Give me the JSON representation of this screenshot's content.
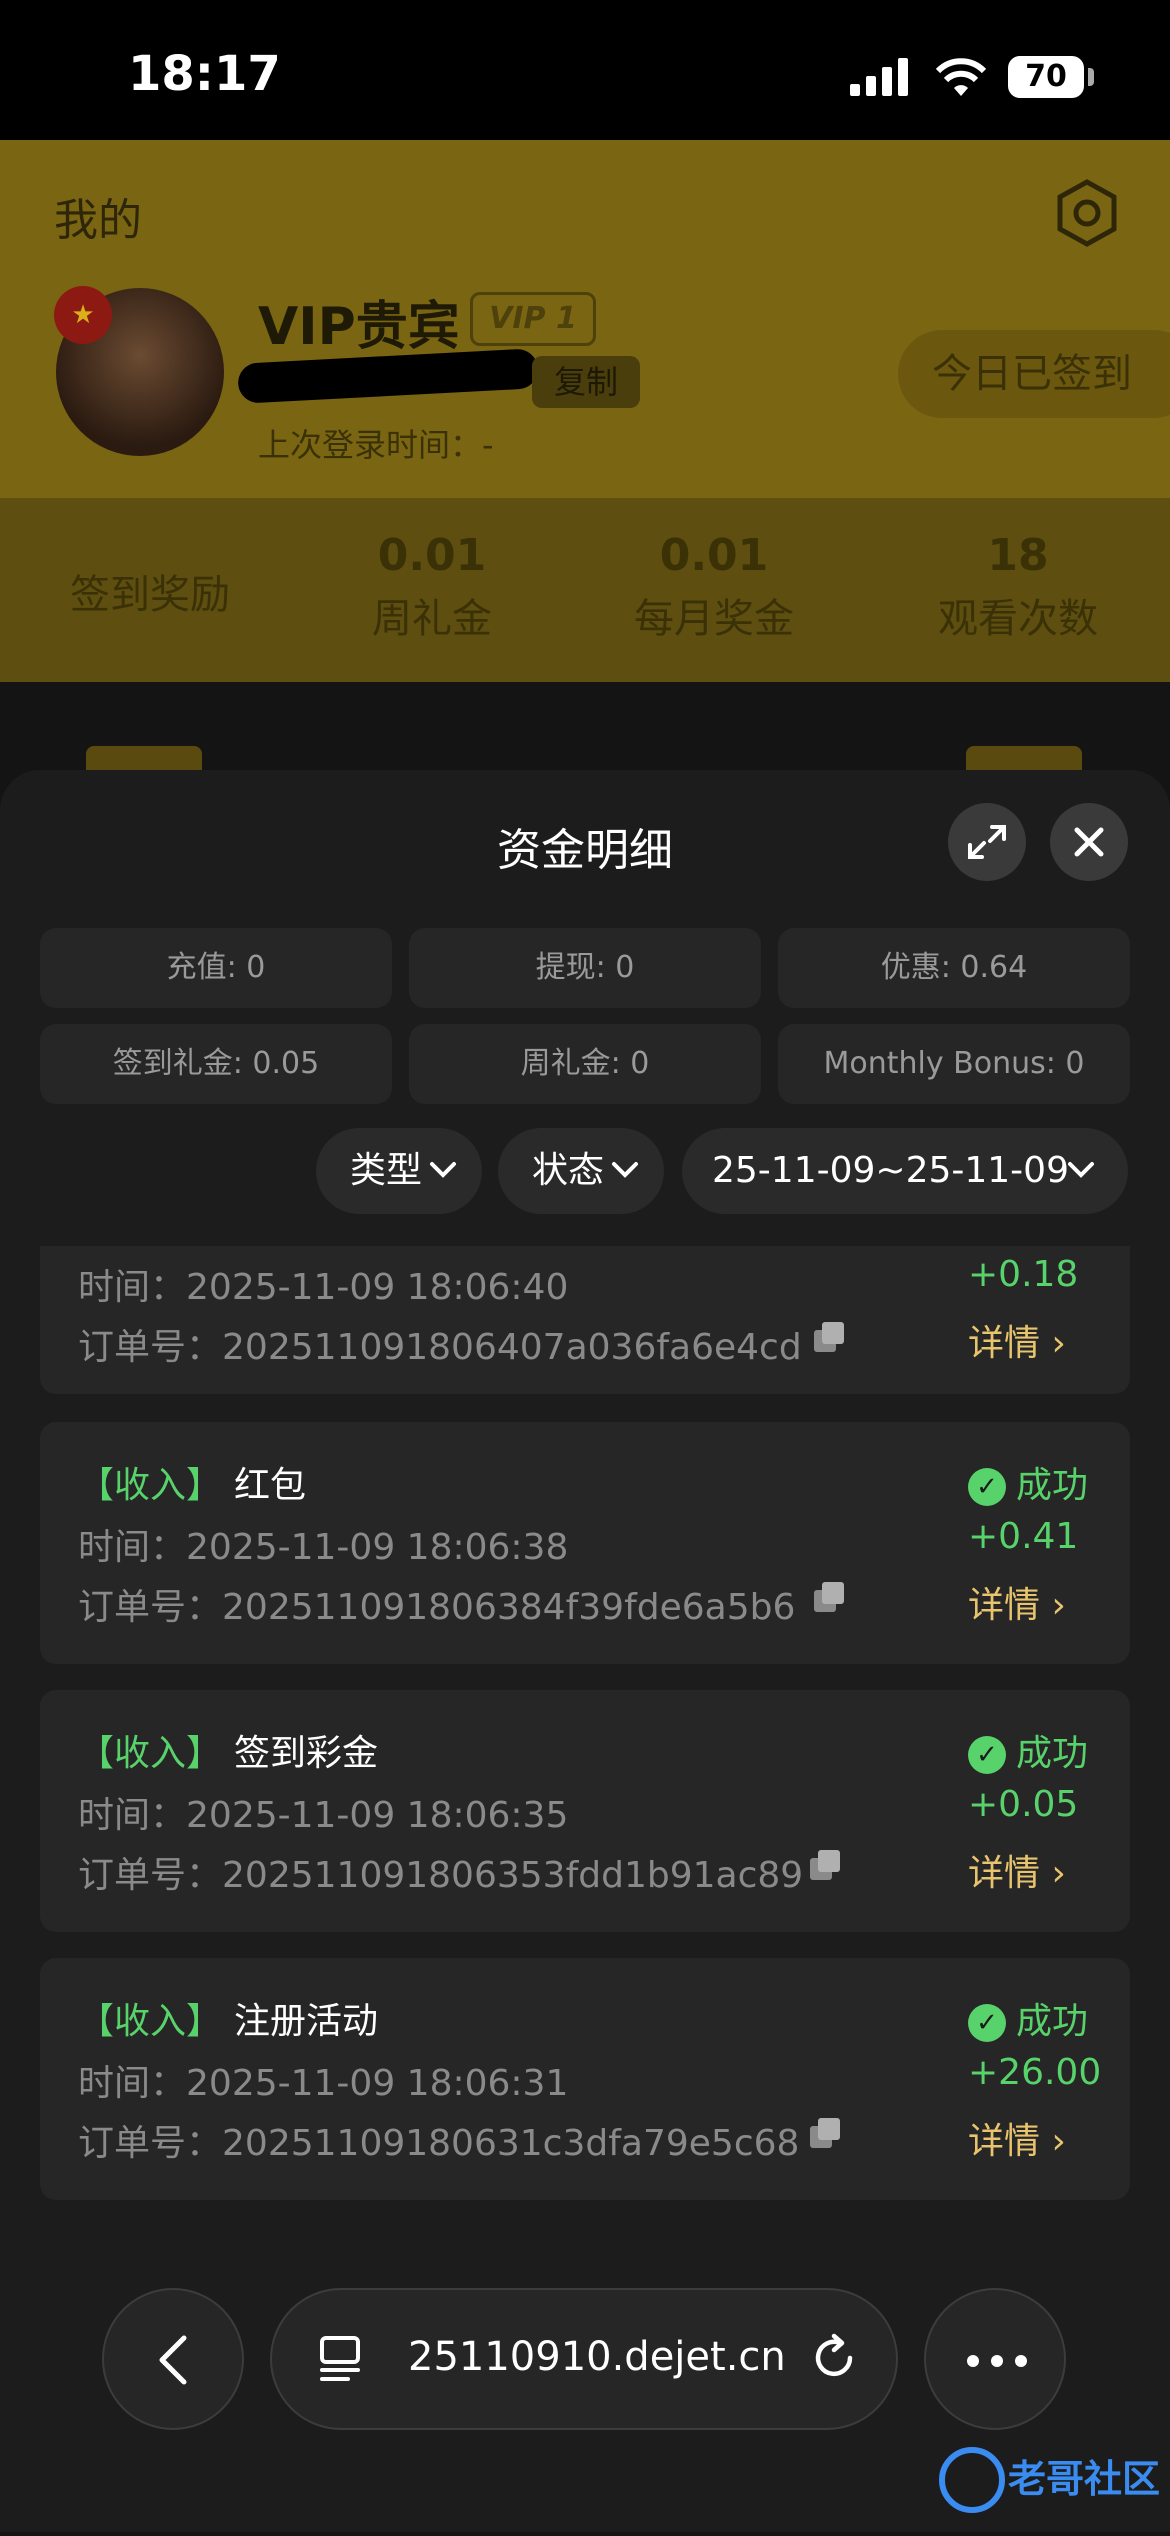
{
  "status_bar": {
    "time": "18:17",
    "battery": "70"
  },
  "header": {
    "title": "我的",
    "username": "VIP贵宾",
    "vip_level": "VIP 1",
    "copy_label": "复制",
    "last_login": "上次登录时间：-",
    "checkin_label": "今日已签到"
  },
  "stats": {
    "signin_reward_label": "签到奖励",
    "weekly_value": "0.01",
    "weekly_label": "周礼金",
    "monthly_value": "0.01",
    "monthly_label": "每月奖金",
    "views_value": "18",
    "views_label": "观看次数"
  },
  "sheet": {
    "title": "资金明细",
    "summary": [
      "充值: 0",
      "提现: 0",
      "优惠: 0.64",
      "签到礼金: 0.05",
      "周礼金: 0",
      "Monthly Bonus: 0"
    ],
    "filters": {
      "type": "类型",
      "status": "状态",
      "date_range": "25-11-09~25-11-09"
    },
    "records": [
      {
        "tag": "",
        "title": "",
        "time_label": "时间：",
        "time": "2025-11-09 18:06:40",
        "order_label": "订单号：",
        "order": "202511091806407a036fa6e4cd",
        "status": "",
        "amount": "+0.18",
        "detail": "详情"
      },
      {
        "tag": "【收入】",
        "title": "红包",
        "time_label": "时间：",
        "time": "2025-11-09 18:06:38",
        "order_label": "订单号：",
        "order": "202511091806384f39fde6a5b6",
        "status": "成功",
        "amount": "+0.41",
        "detail": "详情"
      },
      {
        "tag": "【收入】",
        "title": "签到彩金",
        "time_label": "时间：",
        "time": "2025-11-09 18:06:35",
        "order_label": "订单号：",
        "order": "202511091806353fdd1b91ac89",
        "status": "成功",
        "amount": "+0.05",
        "detail": "详情"
      },
      {
        "tag": "【收入】",
        "title": "注册活动",
        "time_label": "时间：",
        "time": "2025-11-09 18:06:31",
        "order_label": "订单号：",
        "order": "20251109180631c3dfa79e5c68",
        "status": "成功",
        "amount": "+26.00",
        "detail": "详情"
      }
    ]
  },
  "browser": {
    "url": "25110910.dejet.cn"
  },
  "watermark": {
    "text": "老哥社区"
  }
}
